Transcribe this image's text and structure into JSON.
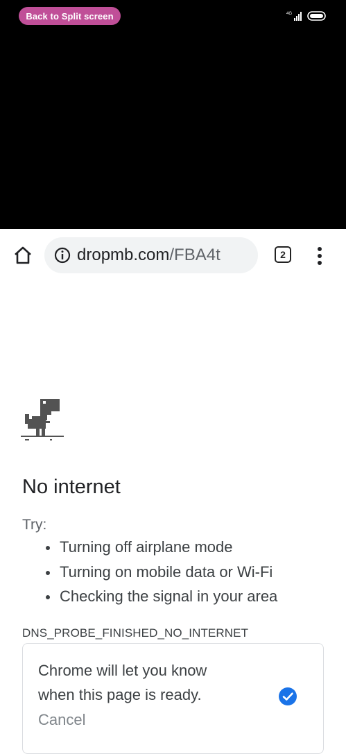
{
  "split": {
    "back_label": "Back to Split screen"
  },
  "status": {
    "network_label": "4G",
    "icons": [
      "signal-icon",
      "battery-icon"
    ]
  },
  "browser": {
    "url_domain": "dropmb.com",
    "url_path": "/FBA4t",
    "tab_count": "2",
    "icons": [
      "home-icon",
      "info-icon",
      "tabs-icon",
      "more-vert-icon"
    ]
  },
  "error_page": {
    "title": "No internet",
    "try_label": "Try:",
    "suggestions": [
      "Turning off airplane mode",
      "Turning on mobile data or Wi-Fi",
      "Checking the signal in your area"
    ],
    "error_code": "DNS_PROBE_FINISHED_NO_INTERNET",
    "notice_line1": "Chrome will let you know",
    "notice_line2": "when this page is ready.",
    "cancel_label": "Cancel"
  },
  "colors": {
    "split_button": "#c04f98",
    "check_blue": "#1a73e8",
    "url_bar_bg": "#f1f3f4"
  }
}
